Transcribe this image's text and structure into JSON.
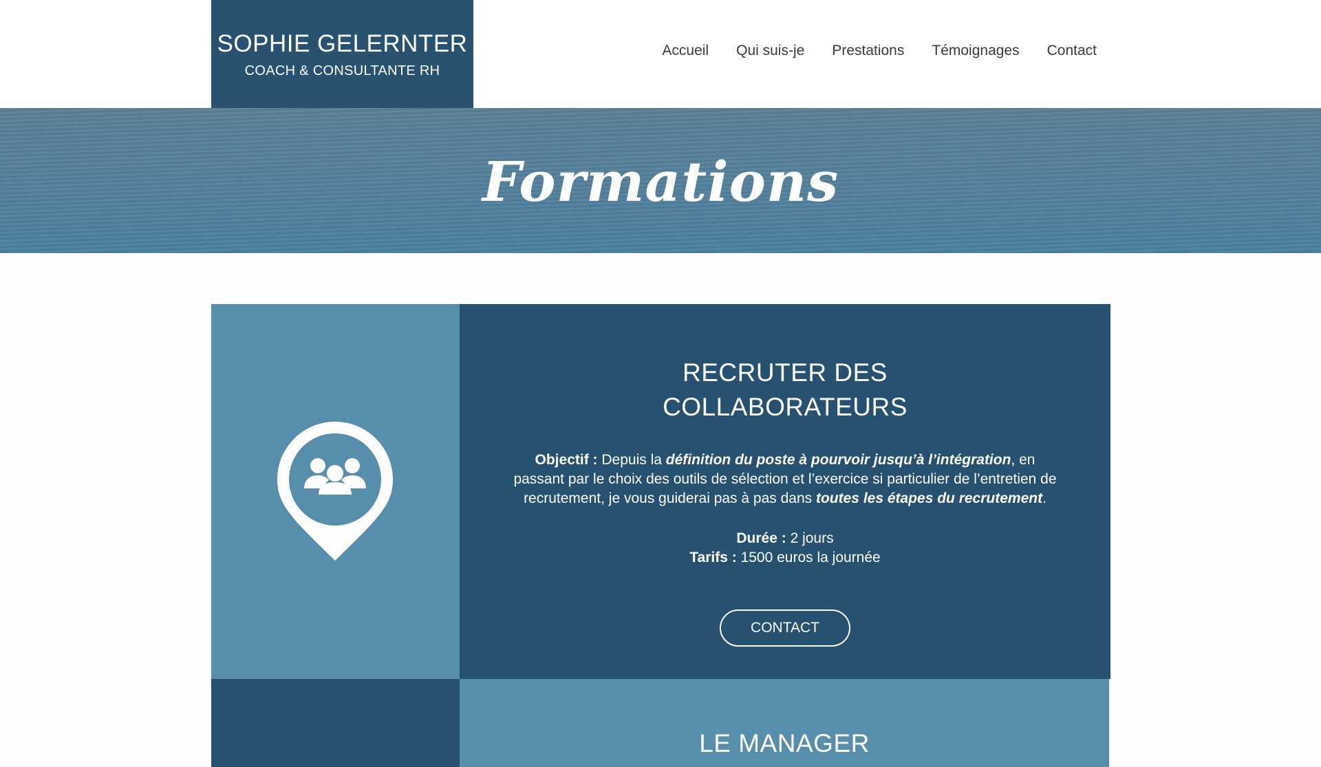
{
  "site": {
    "name": "SOPHIE GELERNTER",
    "subtitle": "COACH & CONSULTANTE RH"
  },
  "nav": {
    "items": [
      "Accueil",
      "Qui suis-je",
      "Prestations",
      "Témoignages",
      "Contact"
    ]
  },
  "hero": {
    "title": "Formations"
  },
  "card1": {
    "title_line1": "RECRUTER DES",
    "title_line2": "COLLABORATEURS",
    "icon": "group-pin-icon",
    "objectif_label": "Objectif :",
    "objectif_pre": " Depuis la ",
    "objectif_em1": "définition du poste à pourvoir jusqu’à l’intégration",
    "objectif_mid": ", en passant par le choix des outils de sélection et l’exercice si particulier de l’entretien de recrutement, je vous guiderai pas à pas dans ",
    "objectif_em2": "toutes les étapes du recrutement",
    "objectif_end": ".",
    "duree_label": "Durée :",
    "duree_value": " 2 jours",
    "tarifs_label": "Tarifs :",
    "tarifs_value": " 1500 euros la journée",
    "cta_label": "CONTACT"
  },
  "card2": {
    "title": "LE MANAGER"
  },
  "colors": {
    "dark_blue": "#275170",
    "light_blue": "#568eac",
    "hero_blue": "#52809c"
  }
}
